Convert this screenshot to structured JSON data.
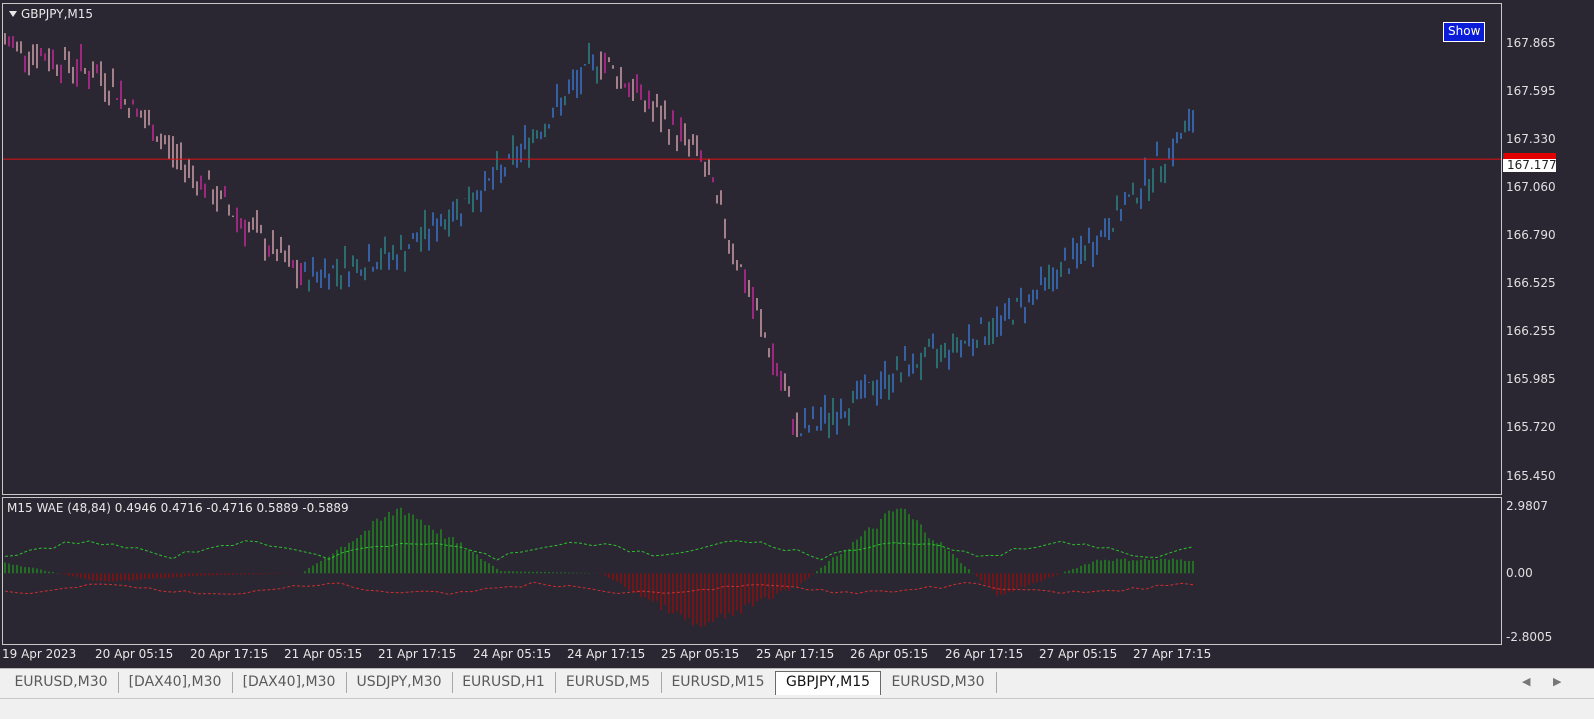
{
  "window": {
    "symbol_title": "GBPJPY,M15",
    "show_button": "Show"
  },
  "price_axis": {
    "ticks": [
      "167.865",
      "167.595",
      "167.330",
      "167.060",
      "166.790",
      "166.525",
      "166.255",
      "165.985",
      "165.720",
      "165.450"
    ],
    "current_price": "167.177"
  },
  "indicator": {
    "label": "M15 WAE (48,84) 0.4946 0.4716 -0.4716 0.5889 -0.5889",
    "axis_ticks": [
      "2.9807",
      "0.00",
      "-2.8005"
    ]
  },
  "time_axis": {
    "ticks": [
      "19 Apr 2023",
      "20 Apr 05:15",
      "20 Apr 17:15",
      "21 Apr 05:15",
      "21 Apr 17:15",
      "24 Apr 05:15",
      "24 Apr 17:15",
      "25 Apr 05:15",
      "25 Apr 17:15",
      "26 Apr 05:15",
      "26 Apr 17:15",
      "27 Apr 05:15",
      "27 Apr 17:15"
    ]
  },
  "tabs": [
    {
      "label": "EURUSD,M30",
      "active": false
    },
    {
      "label": "[DAX40],M30",
      "active": false
    },
    {
      "label": "[DAX40],M30",
      "active": false
    },
    {
      "label": "USDJPY,M30",
      "active": false
    },
    {
      "label": "EURUSD,H1",
      "active": false
    },
    {
      "label": "EURUSD,M5",
      "active": false
    },
    {
      "label": "EURUSD,M15",
      "active": false
    },
    {
      "label": "GBPJPY,M15",
      "active": true
    },
    {
      "label": "EURUSD,M30",
      "active": false
    }
  ],
  "colors": {
    "background": "#2a2632",
    "bull_strong": "#3a7bd5",
    "bull_weak": "#2a8a8a",
    "bear_weak": "#d8a8b0",
    "bear_strong": "#d02aa0",
    "price_line": "#e01010",
    "hist_up": "#1f8f1f",
    "hist_down": "#8b1010",
    "explosion_line": "#2fbf2f",
    "deadzone_line": "#c83030"
  },
  "icons": {
    "dropdown": "triangle-down-icon",
    "scroll_left": "chevron-left-icon",
    "scroll_right": "chevron-right-icon"
  },
  "chart_data": {
    "type": "line",
    "x": [
      "19 Apr 2023",
      "20 Apr 05:15",
      "20 Apr 17:15",
      "21 Apr 05:15",
      "21 Apr 17:15",
      "24 Apr 05:15",
      "24 Apr 17:15",
      "25 Apr 05:15",
      "25 Apr 17:15",
      "26 Apr 05:15",
      "26 Apr 17:15",
      "27 Apr 05:15",
      "27 Apr 17:15"
    ],
    "series": [
      {
        "name": "GBPJPY,M15",
        "values": [
          167.8,
          167.62,
          167.05,
          166.55,
          166.68,
          167.1,
          167.72,
          167.2,
          165.72,
          166.05,
          166.3,
          166.76,
          167.4
        ]
      }
    ],
    "ylim": [
      165.4,
      168.0
    ],
    "current_price": 167.177,
    "indicator": {
      "name": "M15 WAE (48,84)",
      "ylim": [
        -2.8005,
        2.9807
      ],
      "values": [
        0.5,
        -0.4,
        -0.1,
        0.0,
        2.9,
        0.1,
        0.0,
        -2.4,
        -0.5,
        2.9,
        -1.0,
        0.6,
        0.6
      ]
    }
  }
}
